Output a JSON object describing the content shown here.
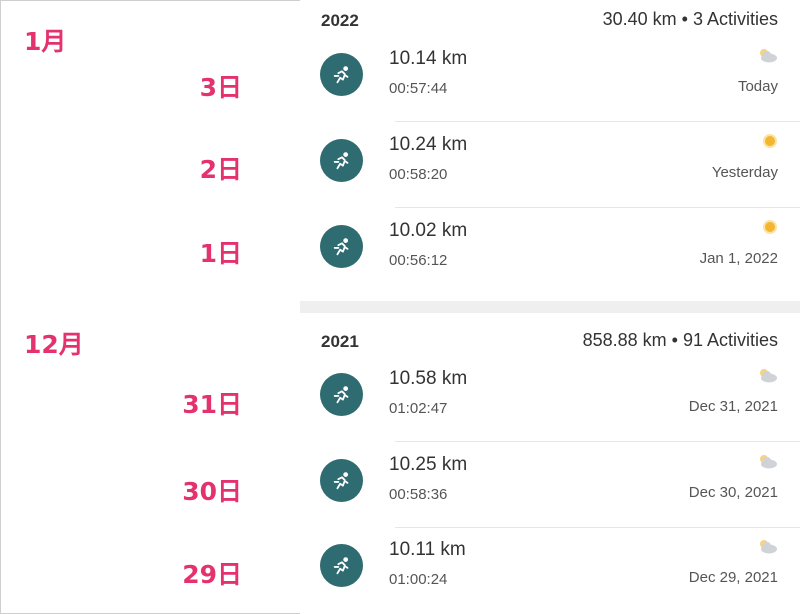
{
  "annotations": {
    "months": [
      "1月",
      "12月"
    ],
    "days_jan": [
      "3日",
      "2日",
      "1日"
    ],
    "days_dec": [
      "31日",
      "30日",
      "29日"
    ]
  },
  "sections": [
    {
      "year": "2022",
      "summary": "30.40 km • 3 Activities",
      "activities": [
        {
          "distance": "10.14 km",
          "duration": "00:57:44",
          "date": "Today",
          "weather": "partly-cloudy-icon"
        },
        {
          "distance": "10.24 km",
          "duration": "00:58:20",
          "date": "Yesterday",
          "weather": "sun-icon"
        },
        {
          "distance": "10.02 km",
          "duration": "00:56:12",
          "date": "Jan 1, 2022",
          "weather": "sun-icon"
        }
      ]
    },
    {
      "year": "2021",
      "summary": "858.88 km • 91 Activities",
      "activities": [
        {
          "distance": "10.58 km",
          "duration": "01:02:47",
          "date": "Dec 31, 2021",
          "weather": "partly-cloudy-icon"
        },
        {
          "distance": "10.25 km",
          "duration": "00:58:36",
          "date": "Dec 30, 2021",
          "weather": "partly-cloudy-icon"
        },
        {
          "distance": "10.11 km",
          "duration": "01:00:24",
          "date": "Dec 29, 2021",
          "weather": "partly-cloudy-icon"
        }
      ]
    }
  ],
  "colors": {
    "annotation": "#e4326e",
    "activity_icon_bg": "#2e6c71",
    "sun": "#f2b632",
    "cloud": "#cfd3d8"
  }
}
